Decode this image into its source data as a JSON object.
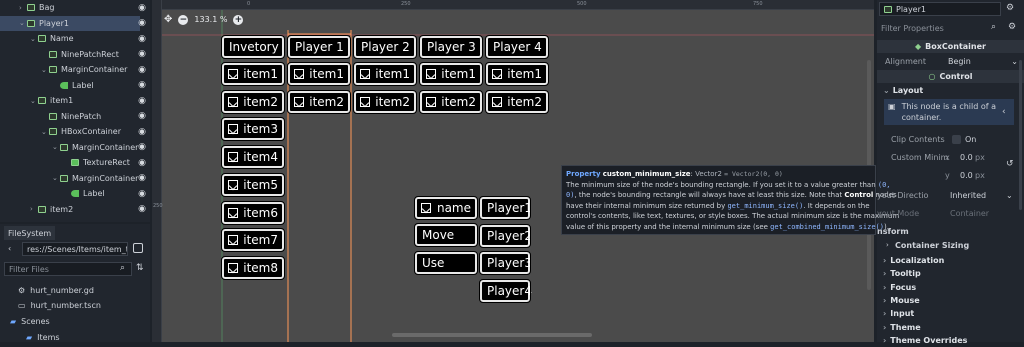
{
  "scene_tree": {
    "rows": [
      {
        "label": "Bag",
        "depth": 1,
        "icon": "node",
        "arrow": "›"
      },
      {
        "label": "Player1",
        "depth": 1,
        "icon": "node",
        "arrow": "⌄",
        "selected": true
      },
      {
        "label": "Name",
        "depth": 2,
        "icon": "node",
        "arrow": "⌄"
      },
      {
        "label": "NinePatchRect",
        "depth": 3,
        "icon": "node",
        "arrow": ""
      },
      {
        "label": "MarginContainer",
        "depth": 3,
        "icon": "node",
        "arrow": "⌄"
      },
      {
        "label": "Label",
        "depth": 4,
        "icon": "label",
        "arrow": ""
      },
      {
        "label": "item1",
        "depth": 2,
        "icon": "node",
        "arrow": "⌄"
      },
      {
        "label": "NinePatch",
        "depth": 3,
        "icon": "node",
        "arrow": ""
      },
      {
        "label": "HBoxContainer",
        "depth": 3,
        "icon": "node",
        "arrow": "⌄"
      },
      {
        "label": "MarginContainer",
        "depth": 4,
        "icon": "node",
        "arrow": "⌄"
      },
      {
        "label": "TextureRect",
        "depth": 5,
        "icon": "image",
        "arrow": ""
      },
      {
        "label": "MarginContainer",
        "depth": 4,
        "icon": "node",
        "arrow": "⌄"
      },
      {
        "label": "Label",
        "depth": 5,
        "icon": "label",
        "arrow": ""
      },
      {
        "label": "item2",
        "depth": 2,
        "icon": "node",
        "arrow": "›"
      }
    ]
  },
  "filesystem": {
    "tab": "FileSystem",
    "path": "res://Scenes/Items/item_t",
    "filter_placeholder": "Filter Files",
    "rows": [
      {
        "label": "hurt_number.gd",
        "icon": "gear-icon"
      },
      {
        "label": "hurt_number.tscn",
        "icon": "scene-icon"
      },
      {
        "label": "Scenes",
        "icon": "folder-icon"
      },
      {
        "label": "Items",
        "icon": "folder-icon"
      }
    ]
  },
  "viewport": {
    "zoom": "133.1 %",
    "ruler_h": [
      "0",
      "250",
      "500",
      "750"
    ],
    "ruler_v": [
      "250"
    ],
    "ui": {
      "headers": [
        "Invetory",
        "Player 1",
        "Player 2",
        "Player 3",
        "Player 4"
      ],
      "item_labels": [
        "item1",
        "item2",
        "item3",
        "item4",
        "item5",
        "item6",
        "item7",
        "item8"
      ],
      "player_items": [
        "item1",
        "item2"
      ],
      "name_btn": "name",
      "menu": [
        "Move",
        "Use"
      ],
      "players": [
        "Player1",
        "Player2",
        "Player3",
        "Player4"
      ]
    }
  },
  "inspector": {
    "node_name": "Player1",
    "filter_placeholder": "Filter Properties",
    "section_box": "BoxContainer",
    "alignment_label": "Alignment",
    "alignment_value": "Begin",
    "section_control": "Control",
    "layout_label": "Layout",
    "child_note": "This node is a child of a container.",
    "clip_label": "Clip Contents",
    "clip_value": "On",
    "min_label": "Custom Minim",
    "min_x": "0.0",
    "min_y": "0.0",
    "unit": "px",
    "dir_label": "yout Directio",
    "dir_value": "Inherited",
    "mode_label": "yout Mode",
    "mode_value": "Container",
    "transform_label": "nsform",
    "container_sizing": "Container Sizing",
    "categories": [
      "Localization",
      "Tooltip",
      "Focus",
      "Mouse",
      "Input",
      "Theme",
      "Theme Overrides"
    ]
  },
  "tooltip": {
    "kw": "Property",
    "name": "custom_minimum_size",
    "type": "Vector2",
    "default": "= Vector2(0, 0)",
    "line1a": "The minimum size of the node's bounding rectangle. If you set it to a value greater than",
    "zero_a": "(0,",
    "zero_b": "0)",
    "line2a": ", the node's bounding rectangle will always have at least this size. Note that",
    "control": "Control",
    "line2b": "nodes",
    "line3a": "have their internal minimum size returned by",
    "fn1": "get_minimum_size()",
    "line3b": ". It depends on the",
    "line4": "control's contents, like text, textures, or style boxes. The actual minimum size is the maximum",
    "line5a": "value of this property and the internal minimum size (see",
    "fn2": "get_combined_minimum_size()",
    "line5b": ")."
  },
  "colors": {
    "accent": "#4d8ef0",
    "selection": "#3b4a63",
    "node_icon": "#8fd18f",
    "guide_orange": "#ff9a5a",
    "guide_green": "#5ccf7a"
  }
}
